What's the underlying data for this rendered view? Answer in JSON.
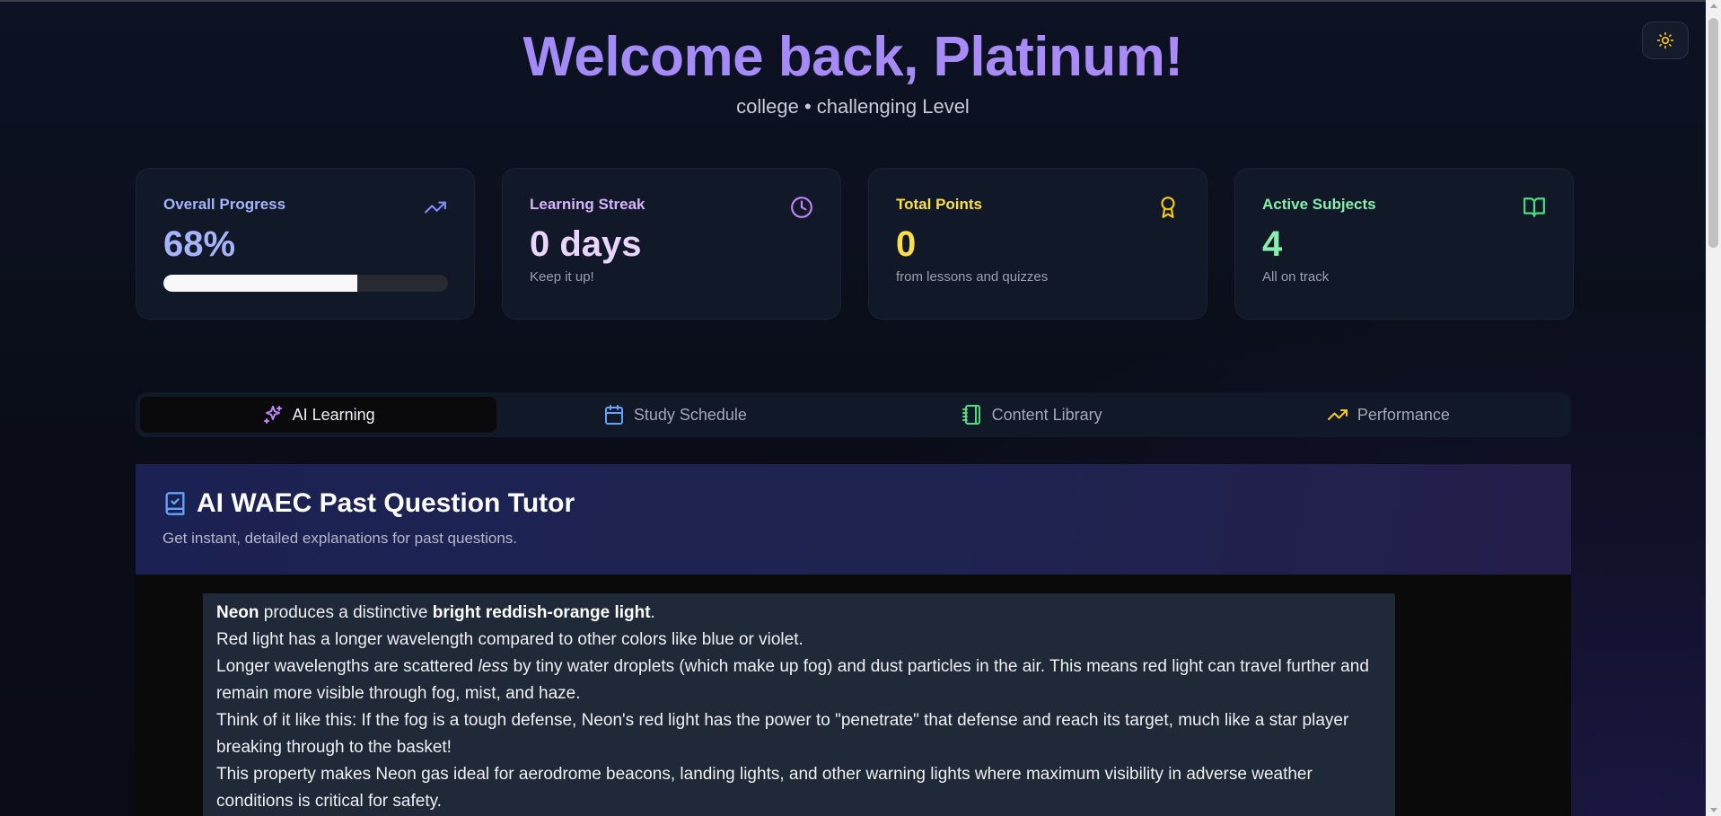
{
  "header": {
    "welcome": "Welcome back, Platinum!",
    "subtitle": "college • challenging Level"
  },
  "theme_toggle": {
    "icon": "sun-icon"
  },
  "stats": {
    "progress": {
      "label": "Overall Progress",
      "value": "68%",
      "fraction": 0.68,
      "icon": "trending-up-icon",
      "color": "#a5b4fc"
    },
    "streak": {
      "label": "Learning Streak",
      "value": "0 days",
      "note": "Keep it up!",
      "icon": "clock-icon",
      "color": "#d8b4fe"
    },
    "points": {
      "label": "Total Points",
      "value": "0",
      "note": "from lessons and quizzes",
      "icon": "award-icon",
      "color": "#fde047"
    },
    "subjects": {
      "label": "Active Subjects",
      "value": "4",
      "note": "All on track",
      "icon": "book-open-icon",
      "color": "#86efac"
    }
  },
  "tabs": [
    {
      "label": "AI Learning",
      "icon": "sparkles-icon",
      "active": true,
      "color": "#c084fc"
    },
    {
      "label": "Study Schedule",
      "icon": "calendar-icon",
      "active": false,
      "color": "#60a5fa"
    },
    {
      "label": "Content Library",
      "icon": "notebook-icon",
      "active": false,
      "color": "#4ade80"
    },
    {
      "label": "Performance",
      "icon": "trending-up-icon",
      "active": false,
      "color": "#facc15"
    }
  ],
  "tutor": {
    "title": "AI WAEC Past Question Tutor",
    "subtitle": "Get instant, detailed explanations for past questions.",
    "icon": "book-check-icon",
    "answer": {
      "p1_bold_a": "Neon",
      "p1_mid": " produces a distinctive ",
      "p1_bold_b": "bright reddish-orange light",
      "p1_end": ".",
      "p2": "Red light has a longer wavelength compared to other colors like blue or violet.",
      "p3_start": "Longer wavelengths are scattered ",
      "p3_italic": "less",
      "p3_end": " by tiny water droplets (which make up fog) and dust particles in the air. This means red light can travel further and remain more visible through fog, mist, and haze.",
      "p4": "Think of it like this: If the fog is a tough defense, Neon's red light has the power to \"penetrate\" that defense and reach its target, much like a star player breaking through to the basket!",
      "p5": "This property makes Neon gas ideal for aerodrome beacons, landing lights, and other warning lights where maximum visibility in adverse weather conditions is critical for safety."
    }
  }
}
